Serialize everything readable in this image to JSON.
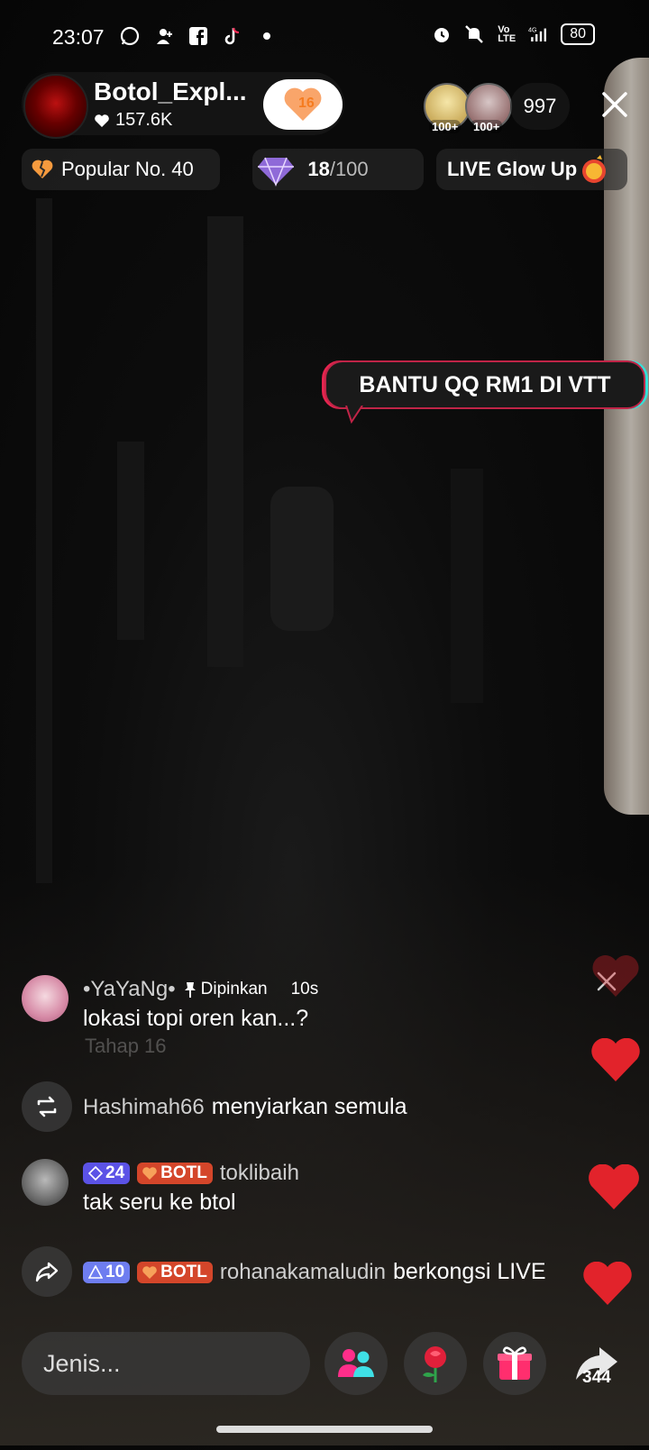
{
  "status_bar": {
    "time": "23:07",
    "icons": [
      "whatsapp-icon",
      "add-user-icon",
      "facebook-icon",
      "tiktok-icon",
      "dot-icon"
    ],
    "right_icons": [
      "alarm-icon",
      "mute-icon",
      "volte-icon",
      "signal-4g-icon"
    ],
    "battery": "80"
  },
  "host": {
    "name": "Botol_Expl...",
    "likes": "157.6K",
    "follow_count": "16"
  },
  "viewers": {
    "avatar1_badge": "100+",
    "avatar2_badge": "100+",
    "count": "997"
  },
  "chips": {
    "popular": "Popular No. 40",
    "progress_current": "18",
    "progress_total": "/100",
    "glow": "LIVE Glow Up"
  },
  "bubble": {
    "text": "BANTU QQ RM1 DI VTT"
  },
  "comments": {
    "pinned": {
      "user": "•YaYaNg•",
      "pin_label": "Dipinkan",
      "time": "10s",
      "text": "lokasi topi oren kan...?"
    },
    "faded": "Tahap 16",
    "repost": {
      "user": "Hashimah66",
      "text": "menyiarkan semula"
    },
    "c1": {
      "level": "24",
      "badge": "BOTL",
      "user": "toklibaih",
      "text": "tak seru ke btol"
    },
    "share": {
      "level": "10",
      "badge": "BOTL",
      "user": "rohanakamaludin",
      "text": "berkongsi LIVE"
    }
  },
  "bottom": {
    "input_placeholder": "Jenis...",
    "share_count": "344"
  },
  "colors": {
    "accent_orange": "#f57c20",
    "heart_red": "#e2232b",
    "badge_purple": "#5b52e6",
    "badge_botl": "#d4462a"
  }
}
